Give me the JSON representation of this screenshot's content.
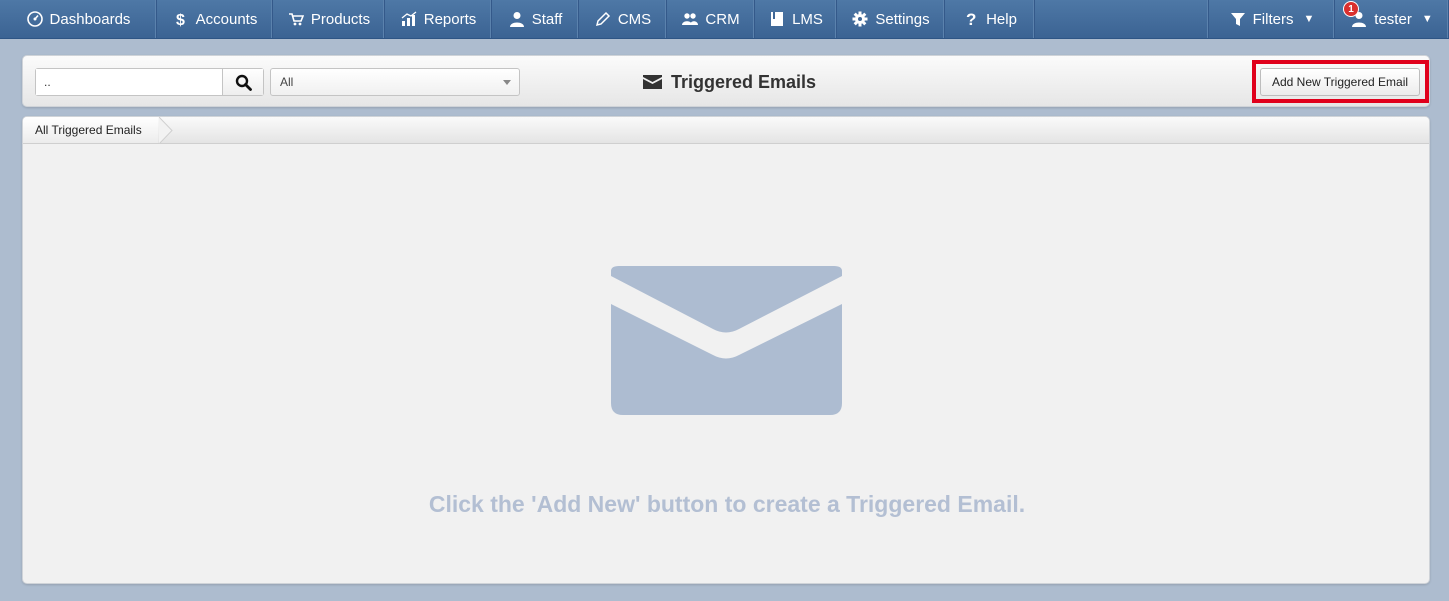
{
  "nav": {
    "items": [
      {
        "label": "Dashboards",
        "icon": "dashboard-icon"
      },
      {
        "label": "Accounts",
        "icon": "dollar-icon"
      },
      {
        "label": "Products",
        "icon": "cart-icon"
      },
      {
        "label": "Reports",
        "icon": "chart-icon"
      },
      {
        "label": "Staff",
        "icon": "user-icon"
      },
      {
        "label": "CMS",
        "icon": "pencil-icon"
      },
      {
        "label": "CRM",
        "icon": "users-icon"
      },
      {
        "label": "LMS",
        "icon": "book-icon"
      },
      {
        "label": "Settings",
        "icon": "gear-icon"
      },
      {
        "label": "Help",
        "icon": "question-icon"
      }
    ],
    "filters_label": "Filters",
    "user_label": "tester",
    "notification_count": "1"
  },
  "toolbar": {
    "search_value": "..",
    "filter_selected": "All",
    "title": "Triggered Emails",
    "add_button_label": "Add New Triggered Email"
  },
  "breadcrumb": {
    "label": "All Triggered Emails"
  },
  "empty_state": {
    "message": "Click the 'Add New' button to create a Triggered Email.",
    "icon": "envelope-icon"
  },
  "colors": {
    "nav_bg": "#3f6797",
    "page_bg": "#adbccf",
    "highlight": "#e0001b",
    "empty_text": "#b3bfd3"
  }
}
